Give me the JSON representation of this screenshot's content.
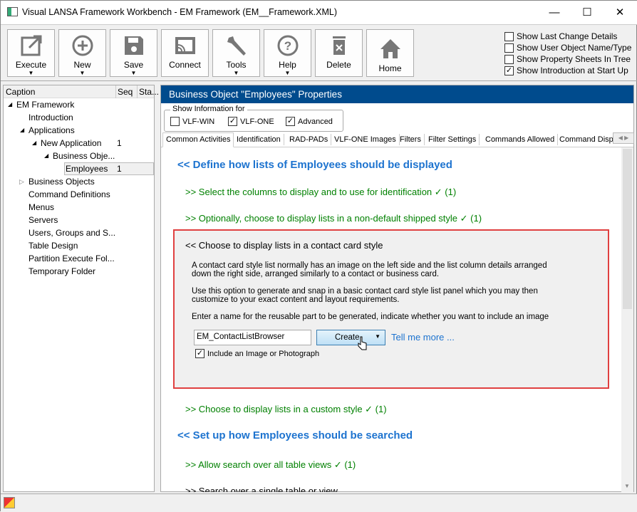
{
  "window": {
    "title": "Visual LANSA Framework Workbench - EM Framework (EM__Framework.XML)",
    "minimize": "—",
    "maximize": "☐",
    "close": "✕"
  },
  "toolbar": {
    "buttons": [
      {
        "label": "Execute",
        "icon": "execute-icon",
        "dropdown": true
      },
      {
        "label": "New",
        "icon": "plus-circle-icon",
        "dropdown": true
      },
      {
        "label": "Save",
        "icon": "floppy-icon",
        "dropdown": true
      },
      {
        "label": "Connect",
        "icon": "cast-icon",
        "dropdown": false
      },
      {
        "label": "Tools",
        "icon": "wrench-icon",
        "dropdown": true
      },
      {
        "label": "Help",
        "icon": "question-icon",
        "dropdown": true
      },
      {
        "label": "Delete",
        "icon": "trash-icon",
        "dropdown": false
      },
      {
        "label": "Home",
        "icon": "home-icon",
        "dropdown": false
      }
    ],
    "options": [
      {
        "label": "Show Last Change Details",
        "checked": false
      },
      {
        "label": "Show User Object Name/Type",
        "checked": false
      },
      {
        "label": "Show Property Sheets In Tree",
        "checked": false
      },
      {
        "label": "Show Introduction at Start Up",
        "checked": true
      }
    ]
  },
  "tree": {
    "columns": [
      "Caption",
      "Seq",
      "Sta..."
    ],
    "items": [
      {
        "label": "EM Framework",
        "seq": "",
        "expander": "◢"
      },
      {
        "label": "Introduction",
        "seq": ""
      },
      {
        "label": "Applications",
        "seq": "",
        "expander": "◢"
      },
      {
        "label": "New Application",
        "seq": "1",
        "expander": "◢"
      },
      {
        "label": "Business Obje...",
        "seq": "",
        "expander": "◢"
      },
      {
        "label": "Employees",
        "seq": "1"
      },
      {
        "label": "Business Objects",
        "seq": "",
        "expander": "▷"
      },
      {
        "label": "Command Definitions",
        "seq": ""
      },
      {
        "label": "Menus",
        "seq": ""
      },
      {
        "label": "Servers",
        "seq": ""
      },
      {
        "label": "Users, Groups and S...",
        "seq": ""
      },
      {
        "label": "Table Design",
        "seq": ""
      },
      {
        "label": "Partition Execute Fol...",
        "seq": ""
      },
      {
        "label": "Temporary Folder",
        "seq": ""
      }
    ]
  },
  "panel": {
    "title": "Business Object \"Employees\" Properties",
    "show_info": {
      "legend": "Show Information for",
      "options": [
        {
          "label": "VLF-WIN",
          "checked": false
        },
        {
          "label": "VLF-ONE",
          "checked": true
        },
        {
          "label": "Advanced",
          "checked": true
        }
      ]
    },
    "tabs": [
      "Common Activities",
      "Identification",
      "RAD-PADs",
      "VLF-ONE Images",
      "Filters",
      "Filter Settings",
      "Commands Allowed",
      "Command Displa"
    ],
    "sections": {
      "h1": "<< Define how lists of Employees should be displayed",
      "l1": ">> Select the columns to display and to use for identification  ✓ (1)",
      "l2": ">> Optionally, choose to display lists in a non-default shipped style  ✓ (1)",
      "box": {
        "title": "<< Choose to display lists in a contact card style",
        "p1a": "A contact card style list normally has an image on the left side and the list column details arranged",
        "p1b": "down the right side, arranged similarly to a contact or business card.",
        "p2a": "Use this option to generate and snap in a basic contact card style list panel which you may then",
        "p2b": "customize to your exact content and layout requirements.",
        "p3": "Enter a name for the reusable part to be generated, indicate whether you want to include an image",
        "input_value": "EM_ContactListBrowser",
        "create_label": "Create",
        "tell_more": "Tell me more ...",
        "include_image_label": "Include an Image or Photograph",
        "include_image_checked": true
      },
      "l3": ">> Choose to display lists in a custom style  ✓ (1)",
      "h2": "<< Set up how Employees should be searched",
      "l4": ">> Allow search over all table views  ✓ (1)",
      "l5": ">> Search over a single table or view"
    }
  }
}
